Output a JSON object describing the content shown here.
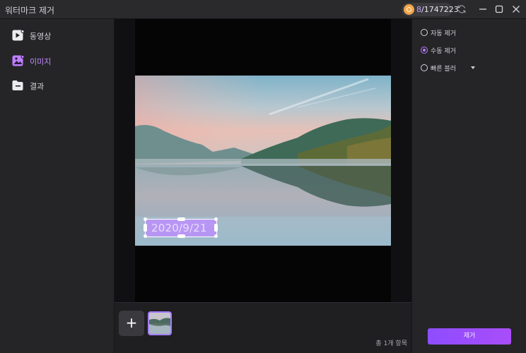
{
  "app": {
    "title": "워터마크 제거"
  },
  "titlebar": {
    "credits_prefix": "8",
    "credits_suffix": "/1747223",
    "coin_color": "#f2a64a",
    "icons": [
      "refresh-icon",
      "minimize-icon",
      "maximize-icon",
      "close-icon"
    ]
  },
  "sidebar": {
    "items": [
      {
        "label": "동영상",
        "icon": "video-icon",
        "active": false
      },
      {
        "label": "이미지",
        "icon": "image-icon",
        "active": true
      },
      {
        "label": "결과",
        "icon": "folder-icon",
        "active": false
      }
    ]
  },
  "canvas": {
    "watermark_text": "2020/9/21"
  },
  "bottom": {
    "add_label": "+",
    "count_text": "총 1개 항목"
  },
  "options": {
    "items": [
      {
        "label": "자동 제거",
        "selected": false
      },
      {
        "label": "수동 제거",
        "selected": true
      },
      {
        "label": "빠른 블러",
        "selected": false,
        "dropdown": true
      }
    ],
    "remove_label": "제거"
  },
  "colors": {
    "accent": "#b77cff",
    "button_gradient_start": "#8e4dff",
    "button_gradient_end": "#a94dfa"
  }
}
